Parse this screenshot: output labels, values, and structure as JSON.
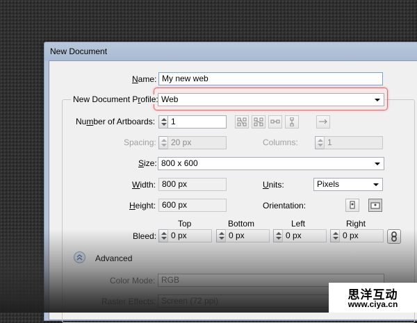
{
  "dialog": {
    "title": "New Document"
  },
  "name": {
    "label": "Name:",
    "value": "My new web"
  },
  "profile": {
    "label": "New Document Profile:",
    "value": "Web"
  },
  "artboards": {
    "label": "Number of Artboards:",
    "value": "1",
    "layout_icons": [
      "grid-by-row-icon",
      "grid-by-column-icon",
      "arrange-by-row-icon",
      "arrange-by-column-icon",
      "right-to-left-icon"
    ]
  },
  "spacing": {
    "label": "Spacing:",
    "value": "20 px"
  },
  "columns": {
    "label": "Columns:",
    "value": "1"
  },
  "size": {
    "label": "Size:",
    "value": "800 x 600"
  },
  "width": {
    "label": "Width:",
    "value": "800 px"
  },
  "units": {
    "label": "Units:",
    "value": "Pixels"
  },
  "height": {
    "label": "Height:",
    "value": "600 px"
  },
  "orientation": {
    "label": "Orientation:",
    "selected": "landscape"
  },
  "bleed": {
    "label": "Bleed:",
    "headers": [
      "Top",
      "Bottom",
      "Left",
      "Right"
    ],
    "values": [
      "0 px",
      "0 px",
      "0 px",
      "0 px"
    ]
  },
  "advanced": {
    "label": "Advanced"
  },
  "color_mode": {
    "label": "Color Mode:",
    "value": "RGB"
  },
  "raster_effects": {
    "label": "Raster Effects:",
    "value": "Screen (72 ppi)"
  },
  "watermark": {
    "line1": "思洋互动",
    "line2": "www.ciya.cn"
  },
  "colors": {
    "highlight": "#e2686e",
    "dialog_frame": "#b4c4d8",
    "background": "#2f2f2f"
  }
}
